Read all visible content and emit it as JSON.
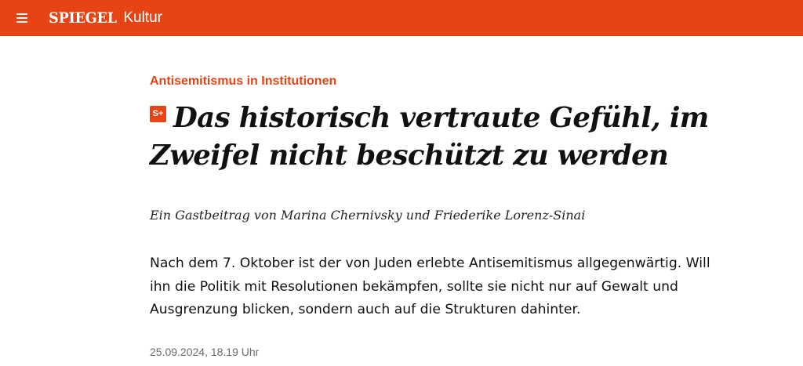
{
  "header": {
    "brand": "SPIEGEL",
    "section": "Kultur",
    "menu_icon": "hamburger-menu-icon",
    "accent_color": "#e64415"
  },
  "article": {
    "kicker": "Antisemitismus in Institutionen",
    "badge": "S+",
    "badge_icon": "spiegel-plus-icon",
    "headline": "Das historisch vertraute Gefühl, im Zweifel nicht beschützt zu werden",
    "author_line": "Ein Gastbeitrag von Marina Chernivsky und Friederike Lorenz-Sinai",
    "teaser": "Nach dem 7. Oktober ist der von Juden erlebte Antisemitismus allgegenwärtig. Will ihn die Politik mit Resolutionen bekämpfen, sollte sie nicht nur auf Gewalt und Ausgrenzung blicken, sondern auch auf die Strukturen dahinter.",
    "date": "25.09.2024, 18.19 Uhr"
  }
}
